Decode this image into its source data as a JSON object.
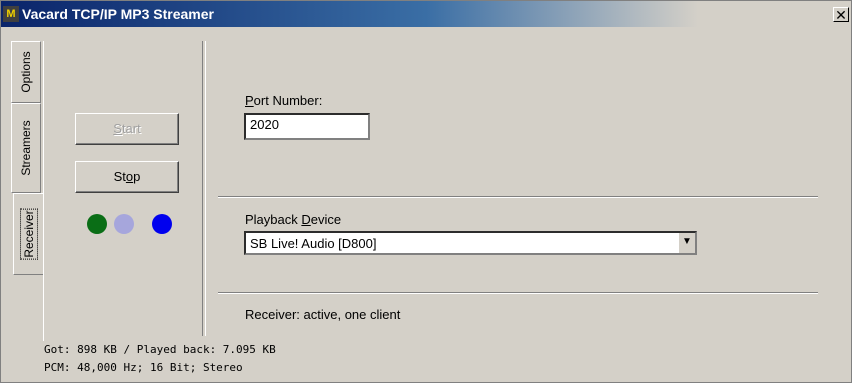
{
  "window": {
    "title": "Vacard TCP/IP MP3 Streamer",
    "app_icon_glyph": "M",
    "close_glyph": "✕"
  },
  "tabs": [
    {
      "label": "Options"
    },
    {
      "label": "Streamers"
    },
    {
      "label": "Receiver",
      "active": true
    }
  ],
  "controls": {
    "start_label": "Start",
    "start_accel": "S",
    "start_rest": "tart",
    "stop_label": "Stop",
    "stop_pre": "St",
    "stop_accel": "o",
    "stop_post": "p"
  },
  "indicators": [
    {
      "name": "green",
      "color": "#0a6e16"
    },
    {
      "name": "lavender",
      "color": "#a6a6dc"
    },
    {
      "name": "blue",
      "color": "#0000ee"
    }
  ],
  "port": {
    "label_accel": "P",
    "label_rest": "ort Number:",
    "value": "2020"
  },
  "playback": {
    "label_pre": "Playback ",
    "label_accel": "D",
    "label_rest": "evice",
    "value": "SB Live! Audio [D800]",
    "arrow": "▼"
  },
  "receiver_status": "Receiver: active, one client",
  "status_lines": [
    "Got: 898 KB / Played back: 7.095 KB",
    "PCM: 48,000 Hz; 16 Bit; Stereo"
  ]
}
